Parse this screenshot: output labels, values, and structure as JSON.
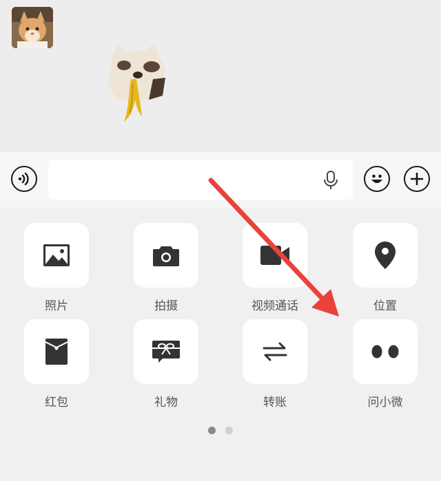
{
  "input": {
    "value": "",
    "placeholder": ""
  },
  "toolbar": {
    "voice_icon": "voice-icon",
    "emoji_icon": "emoji-icon",
    "plus_icon": "plus-icon",
    "mic_icon": "mic-icon"
  },
  "panel": {
    "items": [
      {
        "label": "照片",
        "icon": "photo-icon"
      },
      {
        "label": "拍摄",
        "icon": "camera-icon"
      },
      {
        "label": "视频通话",
        "icon": "video-call-icon"
      },
      {
        "label": "位置",
        "icon": "location-icon"
      },
      {
        "label": "红包",
        "icon": "red-packet-icon"
      },
      {
        "label": "礼物",
        "icon": "gift-icon"
      },
      {
        "label": "转账",
        "icon": "transfer-icon"
      },
      {
        "label": "问小微",
        "icon": "ask-xiaowei-icon"
      }
    ],
    "pager": {
      "page_count": 2,
      "current_page": 1
    }
  },
  "colors": {
    "background": "#ededed",
    "icon": "#333333",
    "arrow": "#e8423b",
    "dot_active": "#888888",
    "dot_inactive": "#d0d0d0"
  }
}
